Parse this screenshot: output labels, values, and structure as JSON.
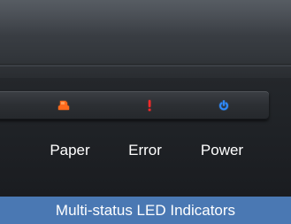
{
  "indicators": [
    {
      "label": "Paper",
      "icon": "paper-jam-icon",
      "color": "#ff6a1a"
    },
    {
      "label": "Error",
      "icon": "exclamation-icon",
      "color": "#ff2a2a"
    },
    {
      "label": "Power",
      "icon": "power-icon",
      "color": "#2f8cff"
    }
  ],
  "caption": "Multi-status LED Indicators",
  "colors": {
    "caption_background": "#4a78b3",
    "device_body": "#1f2226"
  }
}
